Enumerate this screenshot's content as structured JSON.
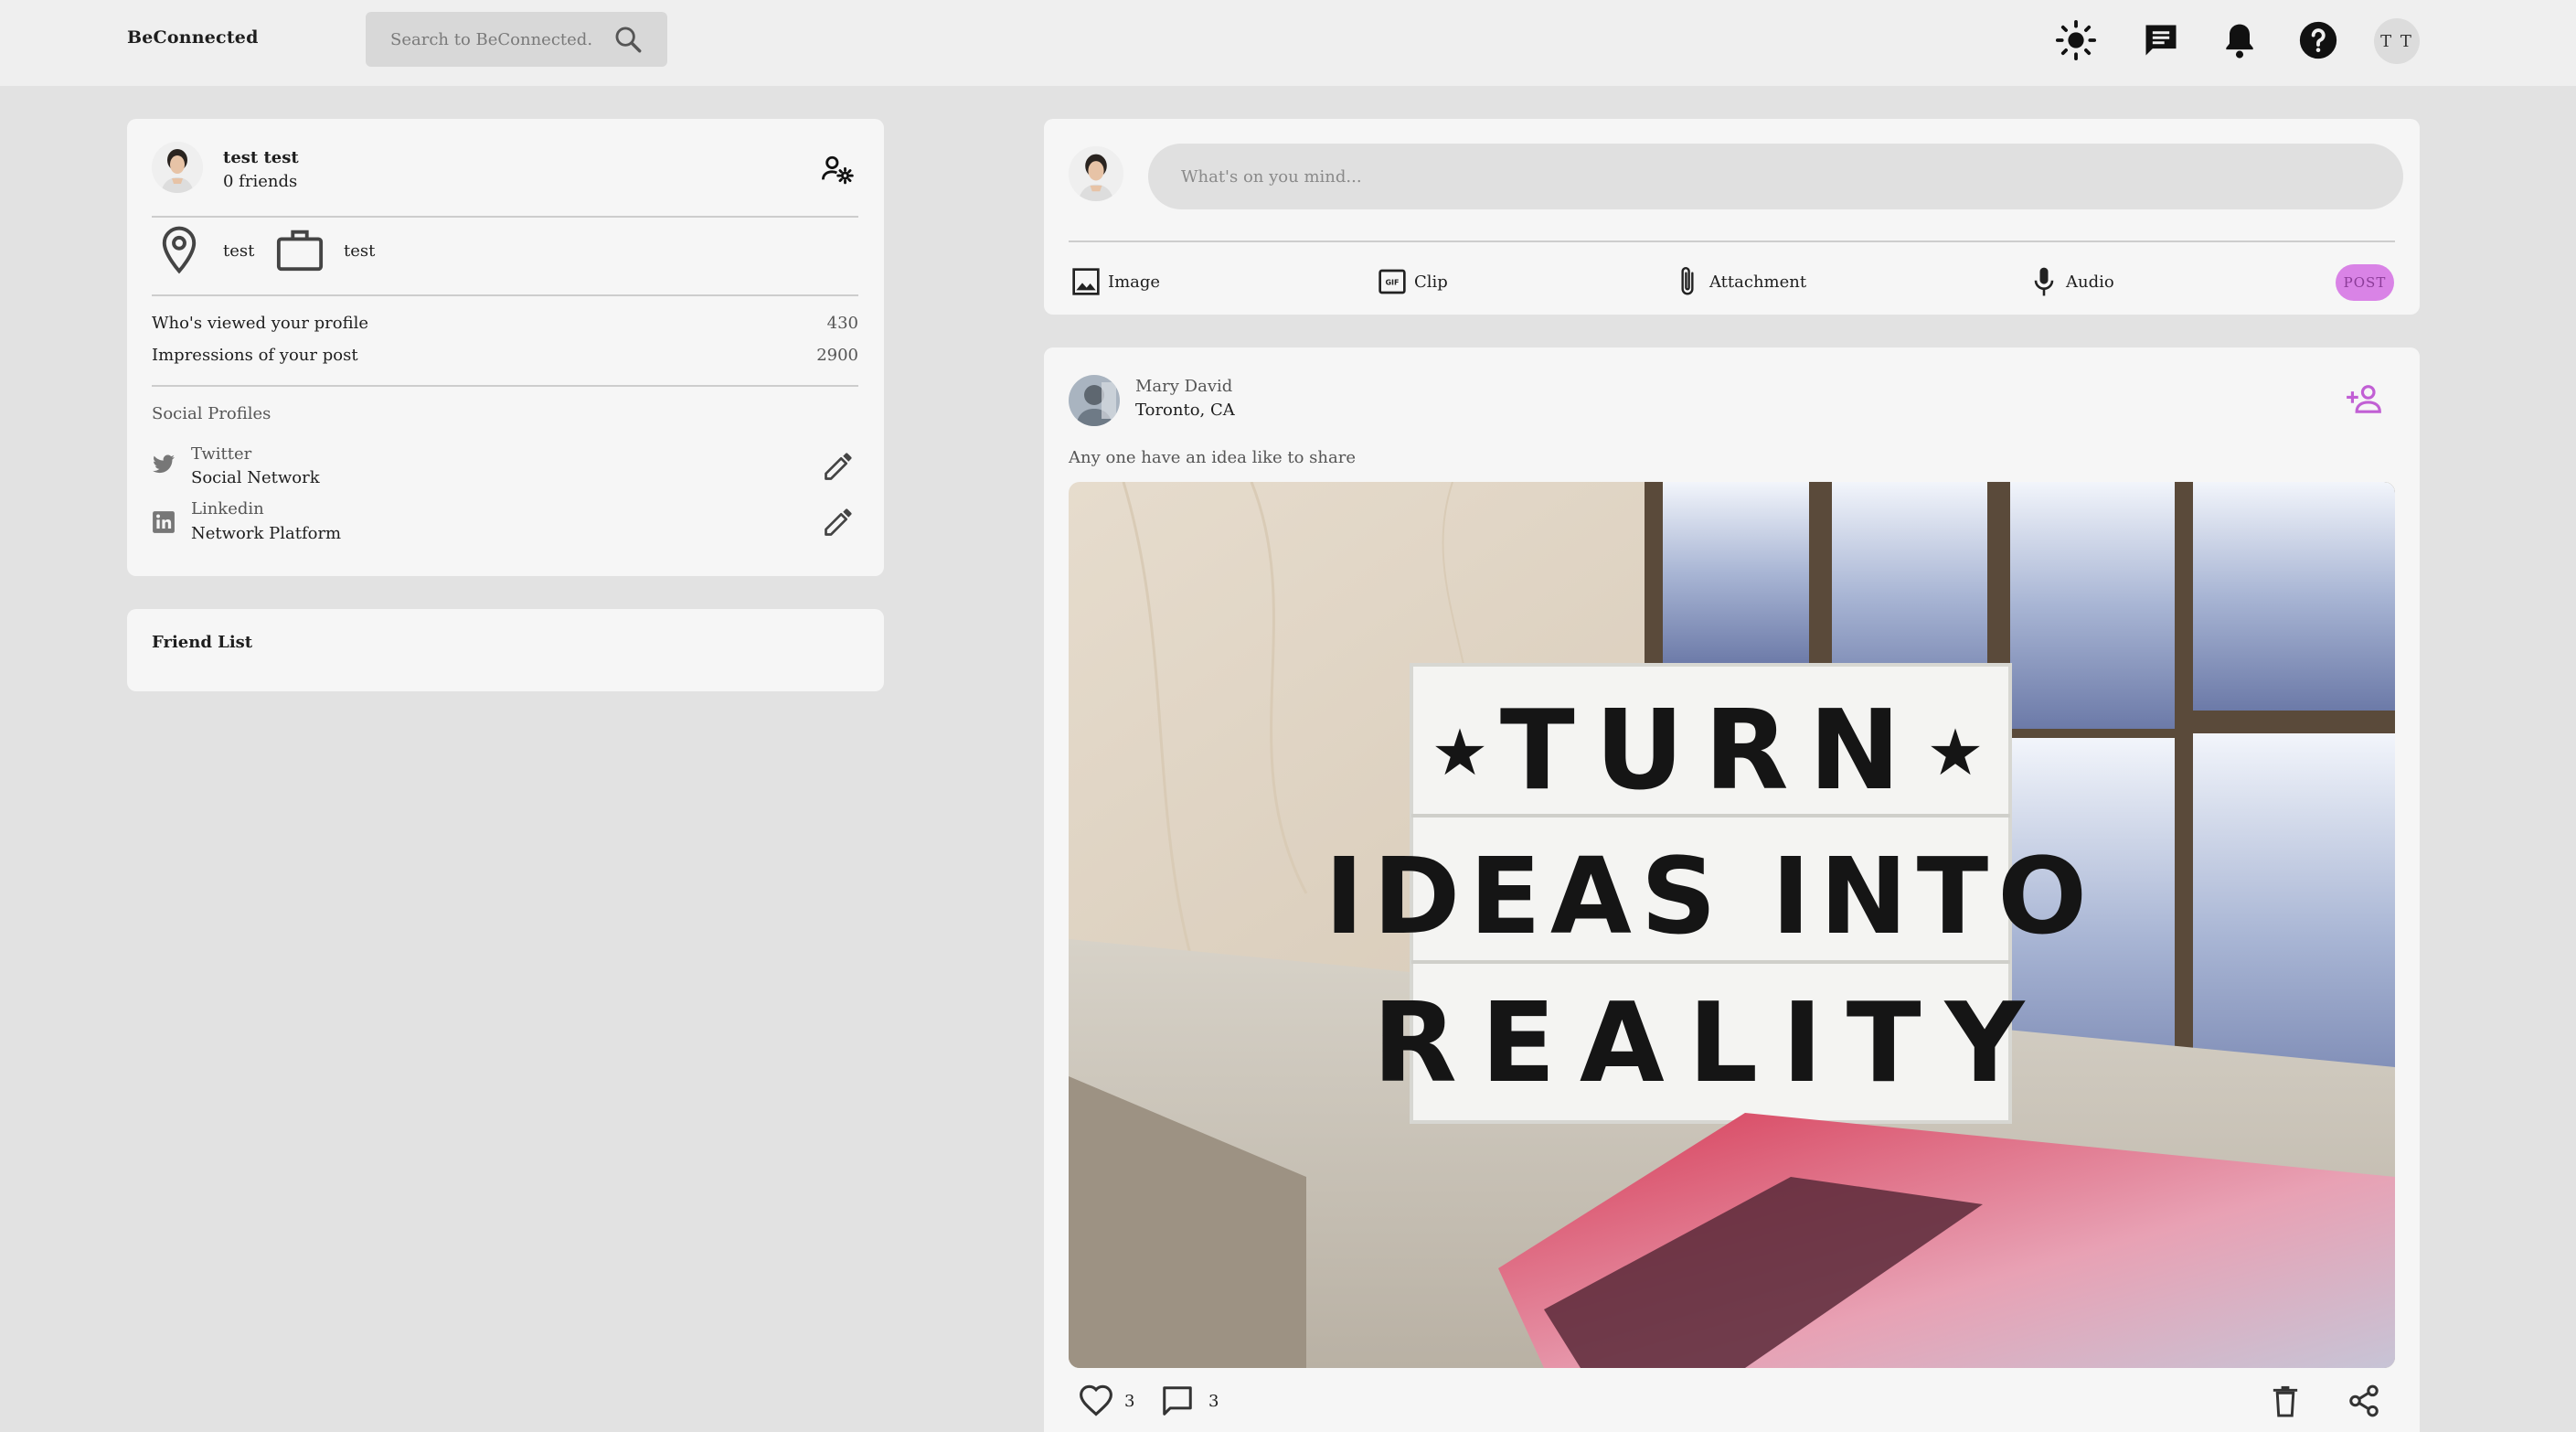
{
  "header": {
    "brand": "BeConnected",
    "search_placeholder": "Search to BeConnected..",
    "icons": [
      "brightness-icon",
      "messages-icon",
      "notifications-icon",
      "help-icon"
    ],
    "user_initials": "T T"
  },
  "profile": {
    "name": "test test",
    "friends": "0 friends",
    "location": "test",
    "occupation": "test",
    "stats": [
      {
        "label": "Who's viewed your profile",
        "value": "430"
      },
      {
        "label": "Impressions of your post",
        "value": "2900"
      }
    ],
    "social_title": "Social Profiles",
    "social": [
      {
        "network": "Twitter",
        "description": "Social Network"
      },
      {
        "network": "Linkedin",
        "description": "Network Platform"
      }
    ]
  },
  "friend_list": {
    "title": "Friend List"
  },
  "composer": {
    "placeholder": "What's on you mind...",
    "actions": {
      "image": "Image",
      "clip": "Clip",
      "attachment": "Attachment",
      "audio": "Audio"
    },
    "post_label": "POST"
  },
  "post": {
    "author": "Mary David",
    "location": "Toronto, CA",
    "text": "Any one have an idea like to share",
    "image_sign": {
      "line1": "TURN",
      "line2": "IDEAS INTO",
      "line3": "REALITY"
    },
    "likes": "3",
    "comments": "3"
  },
  "colors": {
    "page_bg": "#e2e2e2",
    "card_bg": "#f6f6f6",
    "navbar_bg": "#efefef",
    "accent": "#d983e6",
    "accent_text": "#8b3c98",
    "add_friend": "#c15fd4"
  }
}
